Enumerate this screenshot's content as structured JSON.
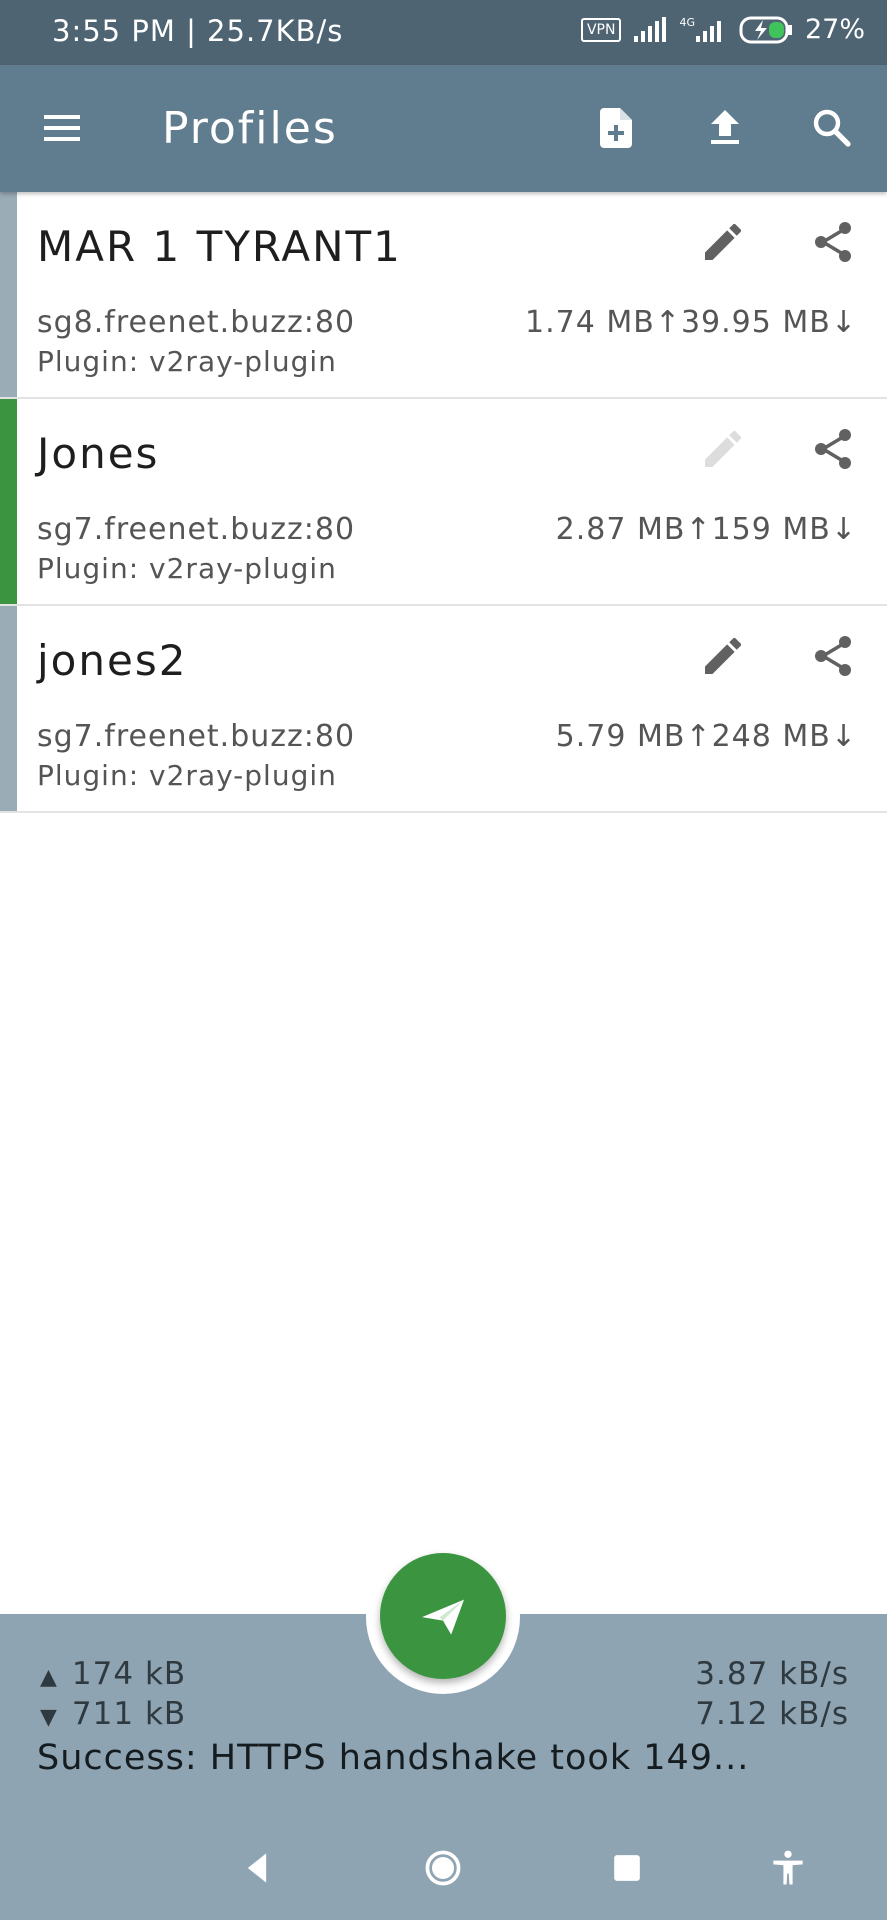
{
  "status_bar": {
    "time_speed": "3:55 PM | 25.7KB/s",
    "vpn": "VPN",
    "network_type": "4G",
    "battery": "27%"
  },
  "app_bar": {
    "title": "Profiles",
    "icons": [
      "menu-icon",
      "add-file-icon",
      "upload-icon",
      "search-icon"
    ]
  },
  "profiles": [
    {
      "name": "MAR 1 TYRANT1",
      "host": "sg8.freenet.buzz:80",
      "plugin": "Plugin: v2ray-plugin",
      "traffic": "1.74 MB↑39.95 MB↓",
      "active": false
    },
    {
      "name": "Jones",
      "host": "sg7.freenet.buzz:80",
      "plugin": "Plugin: v2ray-plugin",
      "traffic": "2.87 MB↑159 MB↓",
      "active": true
    },
    {
      "name": "jones2",
      "host": "sg7.freenet.buzz:80",
      "plugin": "Plugin: v2ray-plugin",
      "traffic": "5.79 MB↑248 MB↓",
      "active": false
    }
  ],
  "stats": {
    "tx_arrow": "▲",
    "rx_arrow": "▼",
    "tx_total": "174 kB",
    "rx_total": "711 kB",
    "tx_rate": "3.87 kB/s",
    "rx_rate": "7.12 kB/s",
    "test_result": "Success: HTTPS handshake took 149..."
  },
  "colors": {
    "status_bar": "#4e6472",
    "app_bar": "#5f7d8e",
    "active_accent": "#3b9540",
    "inactive_accent": "#9aacb6",
    "bottom_bar": "#8fa4b2",
    "fab": "#3b9540"
  },
  "nav_icons": [
    "back-icon",
    "home-icon",
    "recents-icon",
    "accessibility-icon"
  ]
}
